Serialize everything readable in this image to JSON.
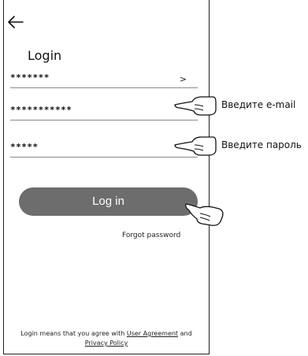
{
  "screen": {
    "title": "Login",
    "back_icon": "back-arrow-icon",
    "fields": [
      {
        "value": "*******",
        "chevron": ">"
      },
      {
        "value": "***********"
      },
      {
        "value": "*****"
      }
    ],
    "login_button": "Log in",
    "forgot_password": "Forgot password",
    "legal": {
      "prefix": "Login means that you agree with",
      "user_agreement": "User Agreement",
      "and": "and",
      "privacy_policy": "Privacy Policy"
    }
  },
  "annotations": {
    "email_hint": "Введите e-mail",
    "password_hint": "Введите пароль",
    "pointer_icon": "pointing-hand-icon"
  }
}
